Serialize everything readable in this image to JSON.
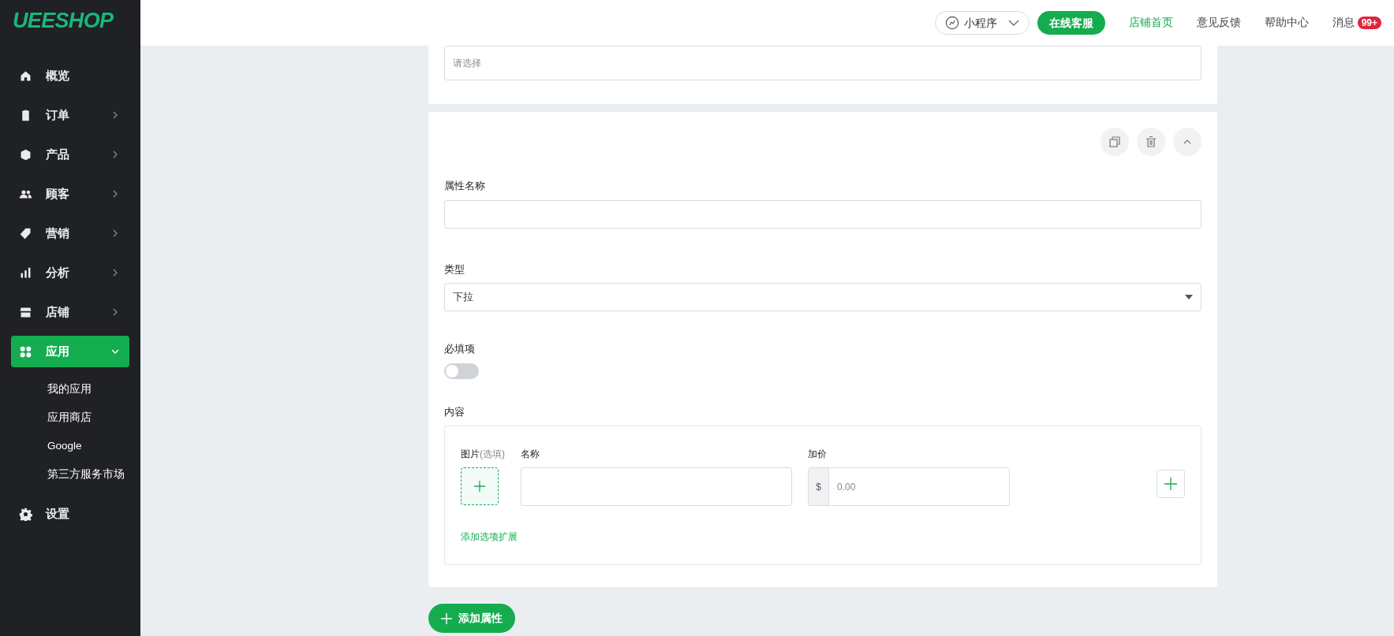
{
  "logo": "UEESHOP",
  "sidebar": {
    "items": [
      {
        "label": "概览",
        "kind": "link",
        "selected": false
      },
      {
        "label": "订单",
        "kind": "group",
        "expanded": false,
        "selected": false
      },
      {
        "label": "产品",
        "kind": "group",
        "expanded": false,
        "selected": false
      },
      {
        "label": "顾客",
        "kind": "group",
        "expanded": false,
        "selected": false
      },
      {
        "label": "营销",
        "kind": "group",
        "expanded": false,
        "selected": false
      },
      {
        "label": "分析",
        "kind": "group",
        "expanded": false,
        "selected": false
      },
      {
        "label": "店铺",
        "kind": "group",
        "expanded": false,
        "selected": false
      },
      {
        "label": "应用",
        "kind": "group",
        "expanded": true,
        "selected": true,
        "children": [
          {
            "label": "我的应用"
          },
          {
            "label": "应用商店"
          },
          {
            "label": "Google"
          },
          {
            "label": "第三方服务市场"
          }
        ]
      },
      {
        "label": "设置",
        "kind": "link",
        "selected": false
      }
    ]
  },
  "topbar": {
    "mini_program": "小程序",
    "service_button": "在线客服",
    "links": [
      {
        "label": "店铺首页",
        "selected": true
      },
      {
        "label": "意见反馈",
        "selected": false
      },
      {
        "label": "帮助中心",
        "selected": false
      },
      {
        "label": "消息",
        "selected": false,
        "badge": "99+"
      }
    ]
  },
  "top_card": {
    "placeholder": "请选择"
  },
  "attribute_card": {
    "name_field": {
      "label": "属性名称"
    },
    "type_field": {
      "label": "类型",
      "value": "下拉"
    },
    "required": {
      "label": "必填项",
      "on": false
    },
    "content": {
      "label": "内容",
      "image_header": "图片",
      "image_hint": "(选填)",
      "name_header": "名称",
      "price_header": "加价",
      "currency": "$",
      "price_placeholder": "0.00",
      "add_link": "添加选项扩展"
    }
  },
  "add_attribute_button": "添加属性"
}
